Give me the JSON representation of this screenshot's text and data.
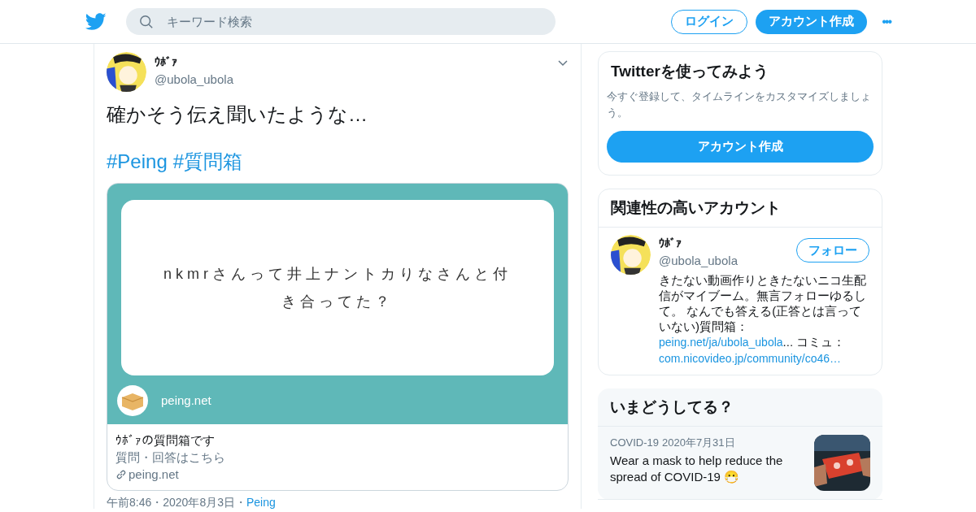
{
  "header": {
    "search": {
      "placeholder": "キーワード検索"
    },
    "buttons": [
      {
        "label": "ログイン",
        "kind": "outline"
      },
      {
        "label": "アカウント作成",
        "kind": "filled"
      }
    ],
    "more": "•••"
  },
  "tweet": {
    "name": "ｳﾎﾞｧ",
    "handle": "@ubola_ubola",
    "text": "確かそう伝え聞いたような…",
    "hashtags": [
      "#Peing",
      "#質問箱"
    ],
    "card": {
      "question": "nkmrさんって井上ナントカりなさんと付き合ってた？",
      "site_badge": "peing.net",
      "title": "ｳﾎﾞｧの質問箱です",
      "description": "質問・回答はこちら",
      "domain": "peing.net"
    },
    "meta": "午前8:46・2020年8月3日・",
    "source": "Peing"
  },
  "signup": {
    "title": "Twitterを使ってみよう",
    "text": "今すぐ登録して、タイムラインをカスタマイズしましょう。",
    "button": "アカウント作成"
  },
  "related": {
    "title": "関連性の高いアカウント",
    "account": {
      "name": "ｳﾎﾞｧ",
      "handle": "@ubola_ubola",
      "follow": "フォロー",
      "bio": [
        {
          "kind": "text",
          "text": "きたない動画作りときたないニコ生配信がマイブーム。無言フォローゆるして。 なんでも答える(正答とは言っていない)質問箱："
        },
        {
          "kind": "link",
          "text": "peing.net/ja/ubola_ubola"
        },
        {
          "kind": "text",
          "text": "... コミュ："
        },
        {
          "kind": "link",
          "text": "com.nicovideo.jp/community/co46"
        },
        {
          "kind": "link",
          "text": "…"
        }
      ]
    }
  },
  "trends": {
    "title": "いまどうしてる？",
    "items": [
      {
        "category": "COVID-19",
        "date": "2020年7月31日",
        "headline": "Wear a mask to help reduce the spread of COVID-19 😷"
      }
    ]
  }
}
